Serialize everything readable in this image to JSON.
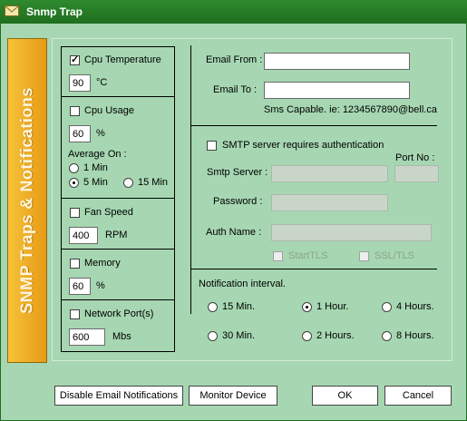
{
  "window": {
    "title": "Snmp Trap"
  },
  "sidebar": {
    "title": "SNMP Traps & Notifications"
  },
  "cpu_temperature": {
    "label": "Cpu Temperature",
    "checked": true,
    "value": "90",
    "unit": "°C"
  },
  "cpu_usage": {
    "label": "Cpu Usage",
    "checked": false,
    "value": "60",
    "unit": "%",
    "average_on_label": "Average On :",
    "options": [
      "1 Min",
      "5 Min",
      "15 Min"
    ],
    "selected": "5 Min"
  },
  "fan_speed": {
    "label": "Fan Speed",
    "checked": false,
    "value": "400",
    "unit": "RPM"
  },
  "memory": {
    "label": "Memory",
    "checked": false,
    "value": "60",
    "unit": "%"
  },
  "network_port": {
    "label": "Network Port(s)",
    "checked": false,
    "value": "600",
    "unit": "Mbs"
  },
  "email": {
    "from_label": "Email From :",
    "from_value": "",
    "to_label": "Email To :",
    "to_value": "",
    "hint": "Sms Capable. ie: 1234567890@bell.ca"
  },
  "smtp": {
    "auth_label": "SMTP server requires authentication",
    "auth_checked": false,
    "server_label": "Smtp Server :",
    "server_value": "",
    "port_label": "Port No :",
    "port_value": "",
    "password_label": "Password :",
    "password_value": "",
    "auth_name_label": "Auth Name :",
    "auth_name_value": "",
    "starttls_label": "StartTLS",
    "ssl_label": "SSL/TLS"
  },
  "notification": {
    "label": "Notification interval.",
    "options": [
      "15 Min.",
      "1 Hour.",
      "4 Hours.",
      "30 Min.",
      "2 Hours.",
      "8 Hours."
    ],
    "selected": "1 Hour."
  },
  "buttons": {
    "disable_email": "Disable Email Notifications",
    "monitor_device": "Monitor Device",
    "ok": "OK",
    "cancel": "Cancel"
  }
}
